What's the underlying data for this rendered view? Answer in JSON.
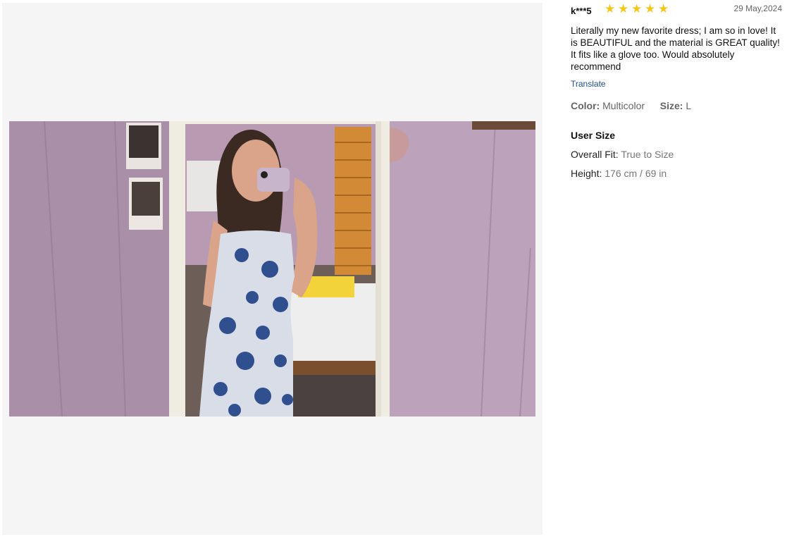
{
  "gallery": {
    "photo_alt": "Customer review photo"
  },
  "review": {
    "reviewer": "k***5",
    "rating": 5,
    "rating_max": 5,
    "date": "29 May,2024",
    "text": "Literally my new favorite dress; I am so in love! It is BEAUTIFUL and the material is GREAT quality! It fits like a glove too. Would absolutely recommend",
    "translate_label": "Translate",
    "color_label": "Color:",
    "color_value": "Multicolor",
    "size_label": "Size:",
    "size_value": "L",
    "user_size_title": "User Size",
    "overall_fit_label": "Overall Fit:",
    "overall_fit_value": "True to Size",
    "height_label": "Height:",
    "height_value": "176 cm / 69 in"
  },
  "colors": {
    "star": "#f5c518",
    "link": "#1e4d91",
    "gallery_bg": "#f5f5f5"
  }
}
